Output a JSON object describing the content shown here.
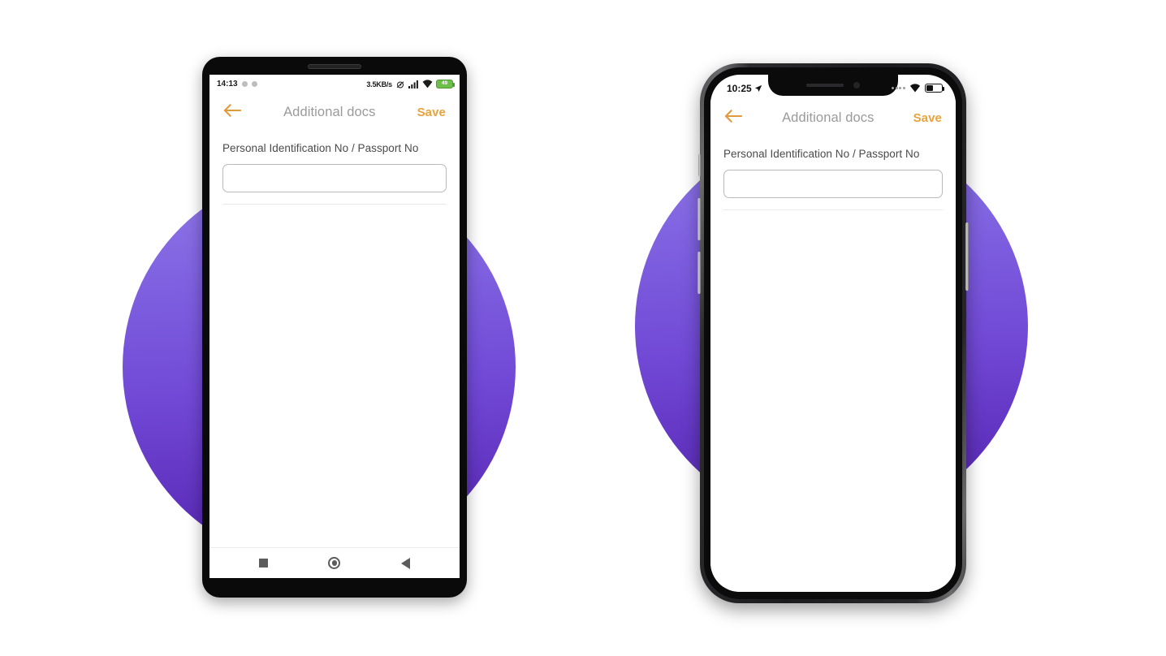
{
  "page": {
    "background_color": "#ffffff",
    "accent_purple_top": "#9179E6",
    "accent_purple_bottom": "#552AAF",
    "accent_orange": "#E8A33D"
  },
  "android_phone": {
    "device_name": "android-phone",
    "status_bar": {
      "time": "14:13",
      "notification_dots": 2,
      "network_speed": "3.5KB/s",
      "icons": [
        "alarm-muted-icon",
        "signal-bars-icon",
        "wifi-icon"
      ],
      "battery_level": "49",
      "battery_color": "#6cc04a"
    },
    "app_bar": {
      "back_icon": "back-arrow-icon",
      "title": "Additional docs",
      "save_label": "Save"
    },
    "form": {
      "field_label": "Personal Identification No / Passport No",
      "field_value": "",
      "field_placeholder": ""
    },
    "nav_bar": {
      "recents_icon": "square-recents-icon",
      "home_icon": "circle-home-icon",
      "back_icon": "triangle-back-icon"
    }
  },
  "iphone": {
    "device_name": "iphone",
    "status_bar": {
      "time": "10:25",
      "location_icon": "location-arrow-icon",
      "signal_icon": "signal-dots-icon",
      "wifi_icon": "wifi-icon",
      "battery_icon": "battery-icon"
    },
    "app_bar": {
      "back_icon": "back-arrow-icon",
      "title": "Additional docs",
      "save_label": "Save"
    },
    "form": {
      "field_label": "Personal Identification No / Passport No",
      "field_value": "",
      "field_placeholder": ""
    }
  }
}
